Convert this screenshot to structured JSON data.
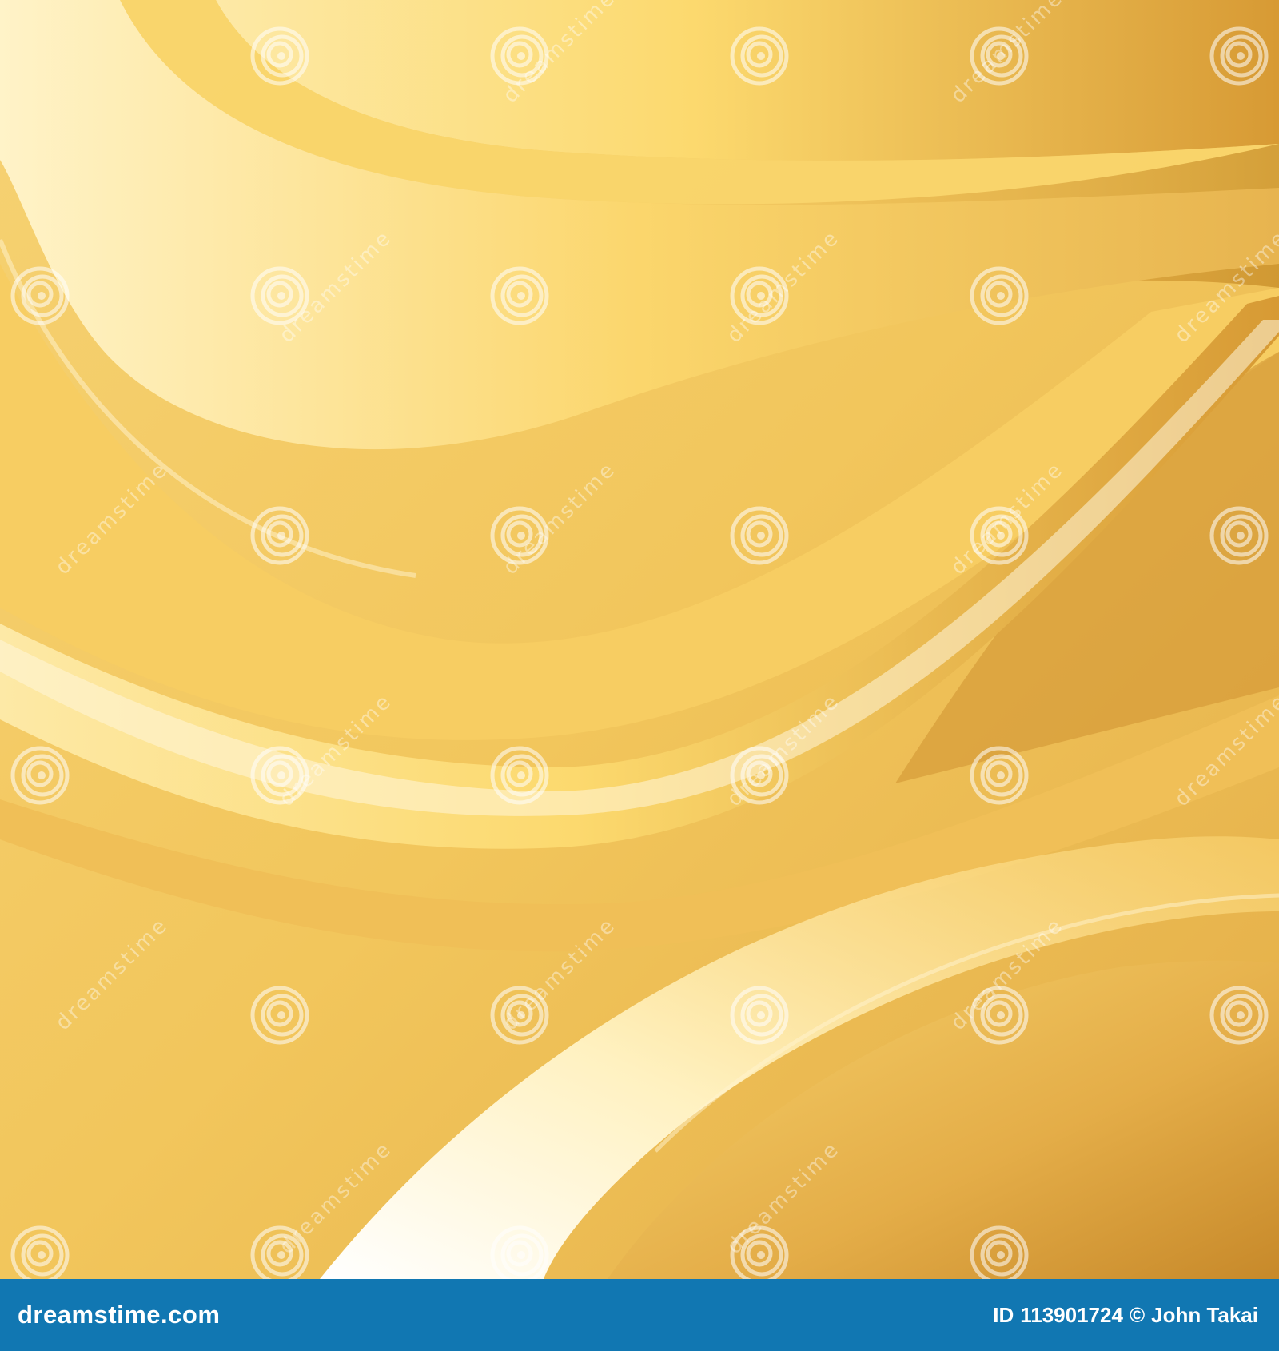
{
  "palette": {
    "base": "#f2c860",
    "light": "#fde08a",
    "highlight": "#fff6dc",
    "shadow": "#c98a2a",
    "deep_shadow": "#b87a1e",
    "footer_bg": "#1177b2",
    "watermark": "#ffffff"
  },
  "watermark": {
    "text": "dreamstime",
    "icon": "spiral-logo-icon"
  },
  "footer": {
    "site": "dreamstime.com",
    "id_label": "ID",
    "id_value": "113901724",
    "copyright_symbol": "©",
    "author": "John Takai"
  }
}
